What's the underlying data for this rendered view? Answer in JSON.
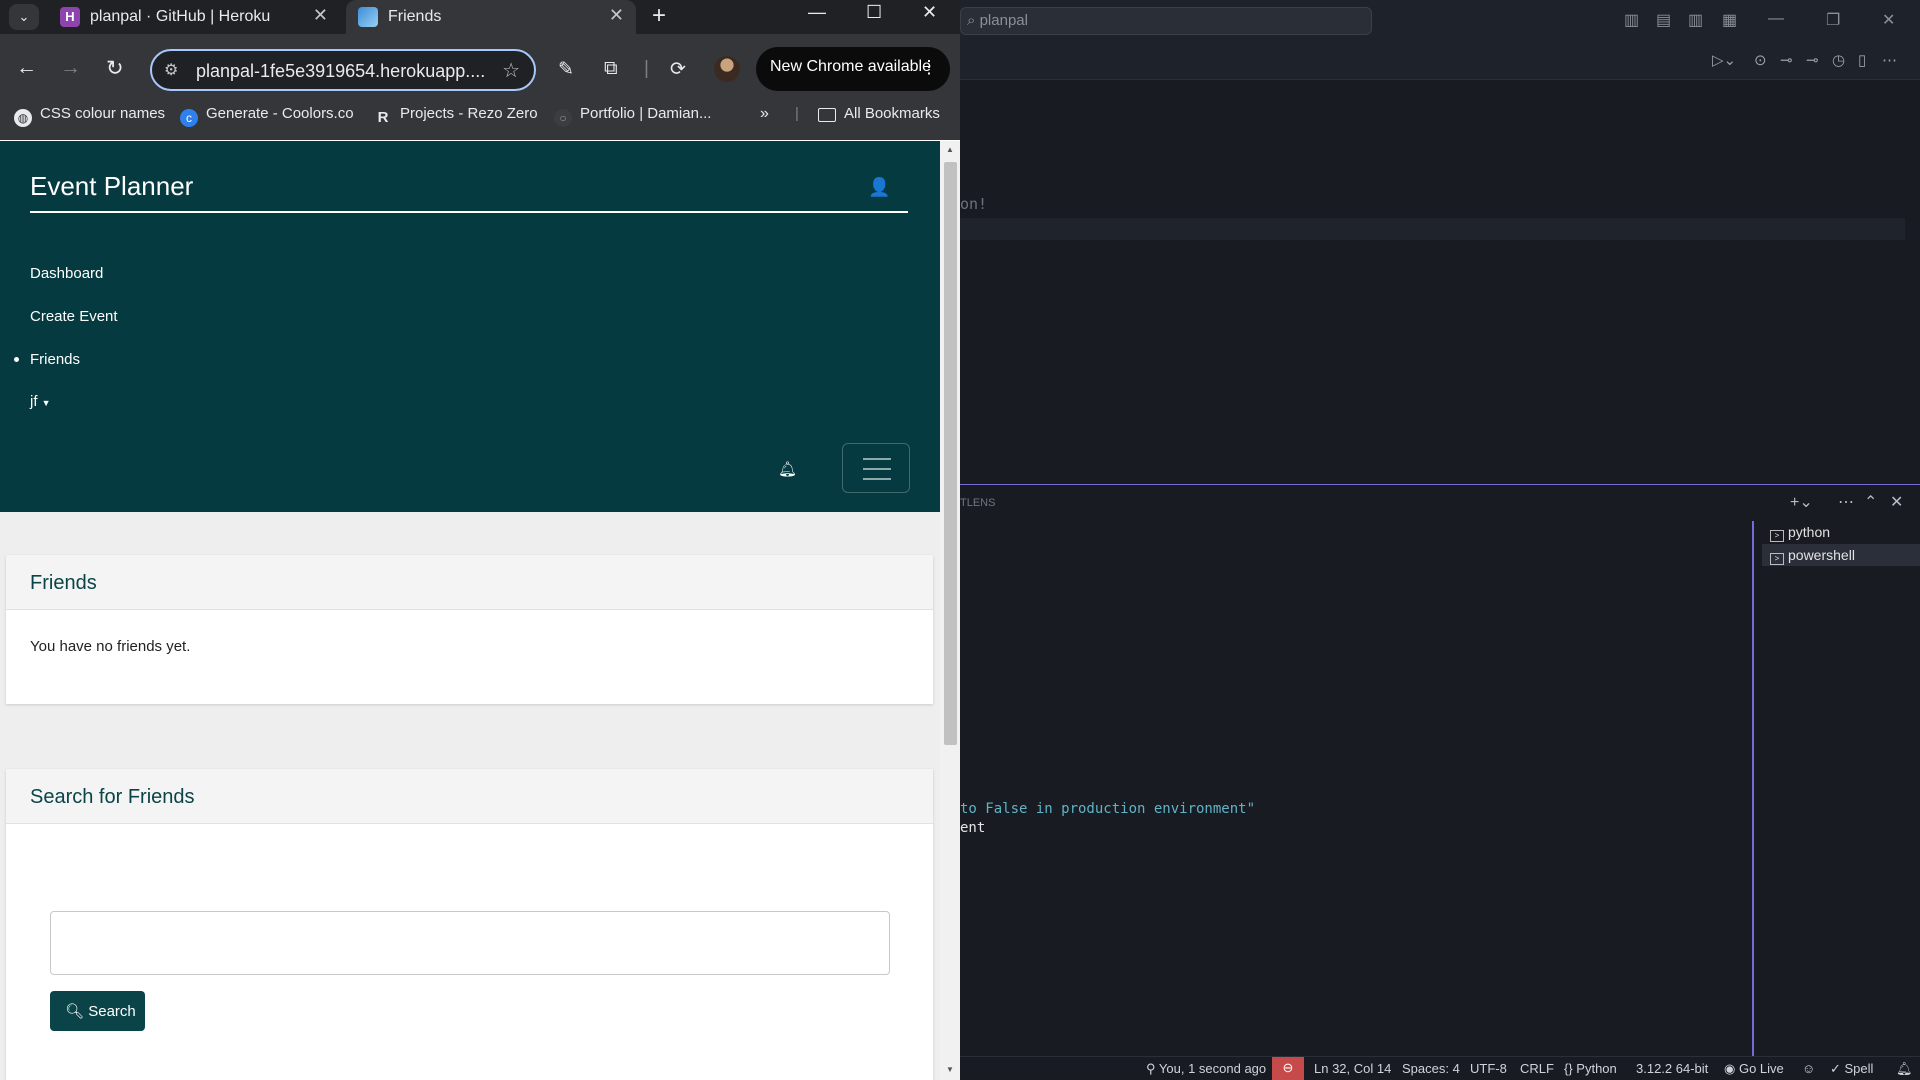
{
  "browser": {
    "tabs": [
      {
        "title": "planpal · GitHub | Heroku",
        "favicon": "heroku-icon",
        "active": false
      },
      {
        "title": "Friends",
        "favicon": "site-icon",
        "active": true
      }
    ],
    "url": "planpal-1fe5e3919654.herokuapp....",
    "update_button": "New Chrome available",
    "bookmarks": [
      {
        "label": "CSS colour names",
        "icon": "globe-icon"
      },
      {
        "label": "Generate - Coolors.co",
        "icon": "coolors-icon"
      },
      {
        "label": "Projects - Rezo Zero",
        "icon": "rezo-icon"
      },
      {
        "label": "Portfolio | Damian...",
        "icon": "portfolio-icon"
      }
    ],
    "all_bookmarks": "All Bookmarks"
  },
  "site": {
    "brand": "Event Planner",
    "nav": [
      {
        "label": "Dashboard",
        "active": false
      },
      {
        "label": "Create Event",
        "active": false
      },
      {
        "label": "Friends",
        "active": true
      },
      {
        "label": "jf",
        "dropdown": true
      }
    ],
    "colors": {
      "primary": "#053b40",
      "button": "#0a4448"
    }
  },
  "friends_section": {
    "title": "Friends",
    "empty_message": "You have no friends yet."
  },
  "search_section": {
    "title": "Search for Friends",
    "input_value": "",
    "button_label": "Search"
  },
  "vscode": {
    "search_text": "planpal",
    "editor_fragment": "on!",
    "panel_label": "TLENS",
    "terminal_lines": [
      "to False in production environment\"",
      "ent"
    ],
    "terminals": [
      "python",
      "powershell"
    ],
    "status": {
      "git": "You, 1 second ago",
      "position": "Ln 32, Col 14",
      "spaces": "Spaces: 4",
      "encoding": "UTF-8",
      "eol": "CRLF",
      "language": "Python",
      "interpreter": "3.12.2 64-bit",
      "golive": "Go Live",
      "spell": "Spell"
    }
  }
}
